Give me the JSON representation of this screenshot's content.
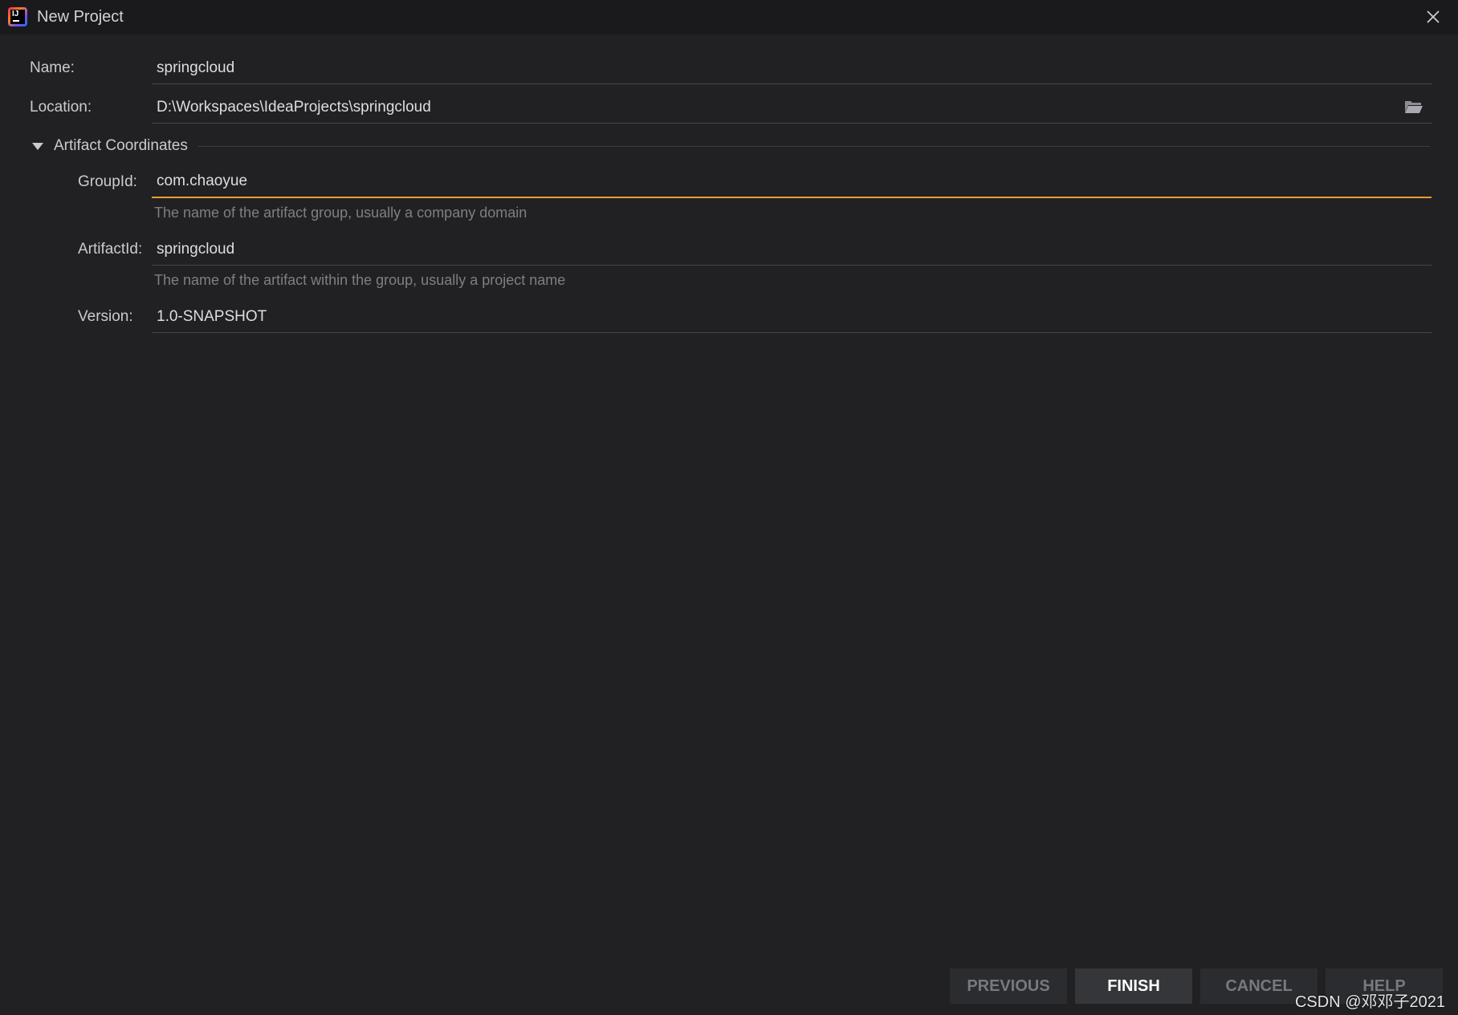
{
  "window": {
    "title": "New Project"
  },
  "form": {
    "name": {
      "label": "Name:",
      "value": "springcloud"
    },
    "location": {
      "label": "Location:",
      "value": "D:\\Workspaces\\IdeaProjects\\springcloud"
    },
    "artifact_section": {
      "title": "Artifact Coordinates",
      "group_id": {
        "label": "GroupId:",
        "value": "com.chaoyue",
        "hint": "The name of the artifact group, usually a company domain"
      },
      "artifact_id": {
        "label": "ArtifactId:",
        "value": "springcloud",
        "hint": "The name of the artifact within the group, usually a project name"
      },
      "version": {
        "label": "Version:",
        "value": "1.0-SNAPSHOT"
      }
    }
  },
  "footer": {
    "previous_label": "PREVIOUS",
    "finish_label": "FINISH",
    "cancel_label": "CANCEL",
    "help_label": "HELP"
  },
  "watermark": "CSDN @邓邓子2021",
  "colors": {
    "background": "#212123",
    "titlebar": "#1a1a1c",
    "focus_accent": "#e3a032",
    "text": "#c9cbd0",
    "hint_text": "#7d7f84"
  },
  "icons": {
    "app_logo": "intellij-idea-icon",
    "close": "close-icon",
    "folder": "folder-open-icon",
    "section_toggle": "triangle-down-icon"
  }
}
